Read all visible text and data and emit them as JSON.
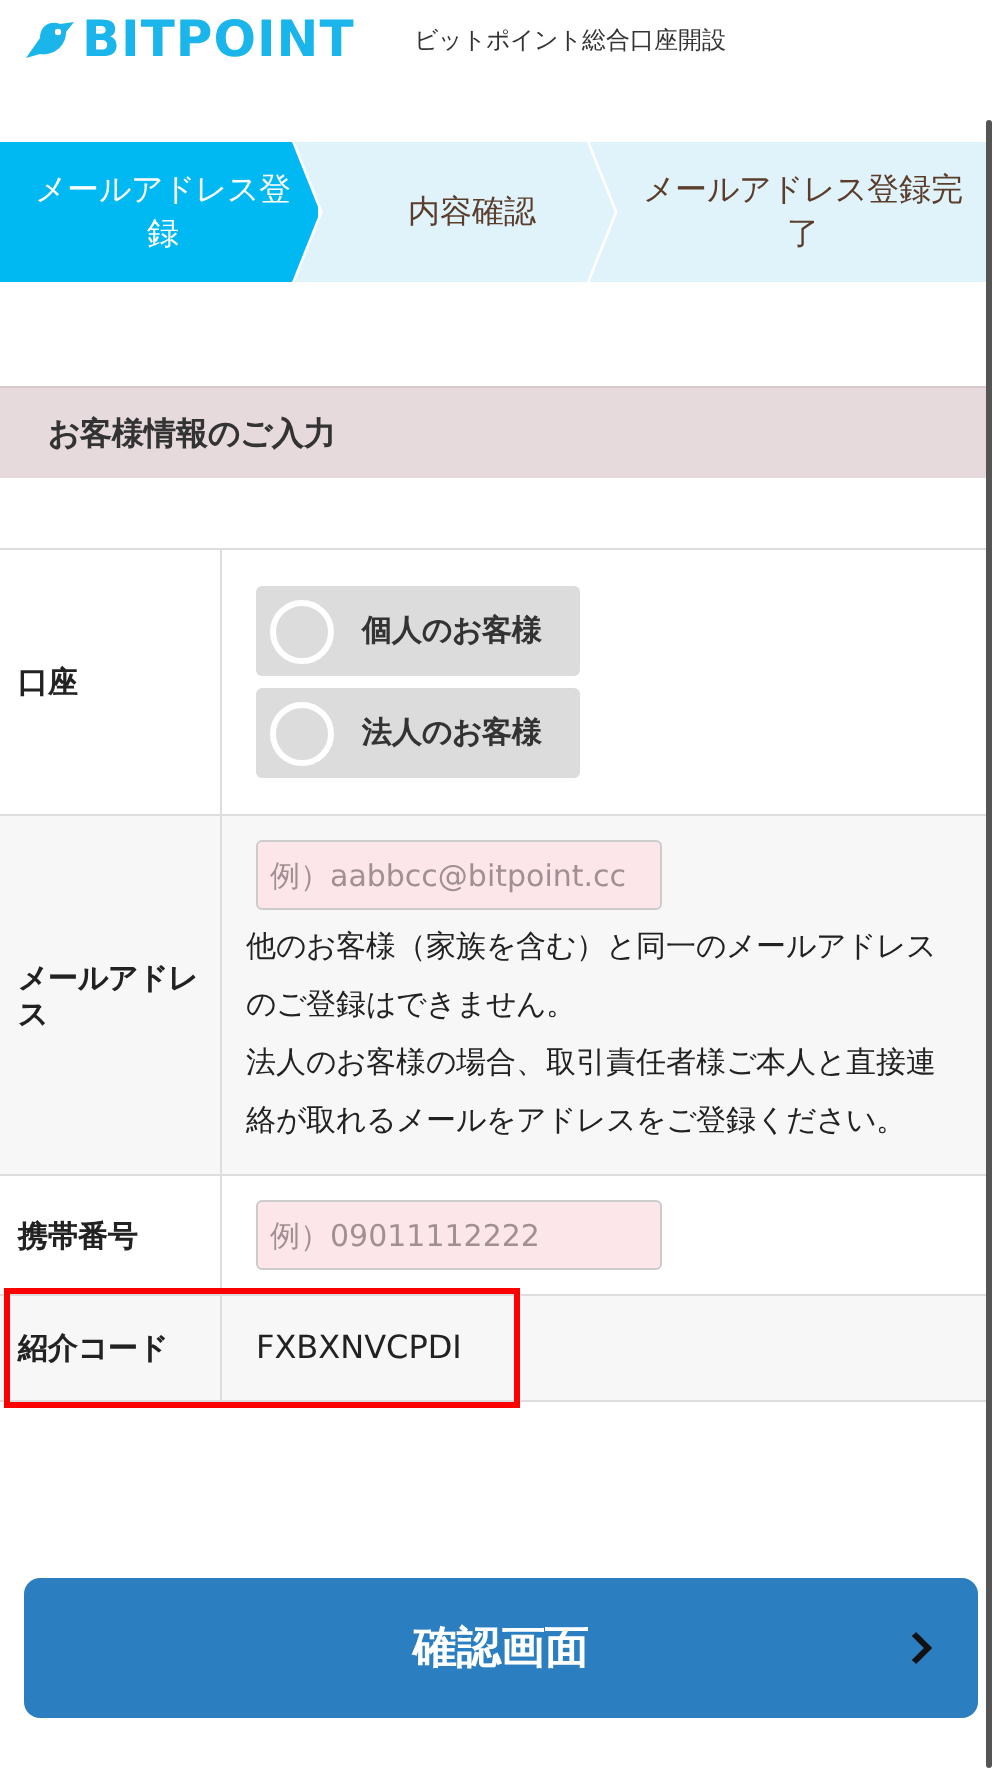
{
  "header": {
    "logo_text": "BITPOINT",
    "title": "ビットポイント総合口座開設"
  },
  "steps": [
    {
      "label": "メールアドレス登録",
      "selected": true
    },
    {
      "label": "内容確認",
      "selected": false
    },
    {
      "label": "メールアドレス登録完了",
      "selected": false
    }
  ],
  "section_title": "お客様情報のご入力",
  "form_rows": [
    {
      "kind": "radio",
      "label": "口座",
      "highlighted": false,
      "options": [
        {
          "label": "個人のお客様",
          "selected": false
        },
        {
          "label": "法人のお客様",
          "selected": false
        }
      ]
    },
    {
      "kind": "input",
      "label": "メールアドレス",
      "highlighted": false,
      "placeholder": "例）aabbcc@bitpoint.cc",
      "notes": [
        "他のお客様（家族を含む）と同一のメールアドレスのご登録はできません。",
        "法人のお客様の場合、取引責任者様ご本人と直接連絡が取れるメールをアドレスをご登録ください。"
      ]
    },
    {
      "kind": "input",
      "label": "携帯番号",
      "highlighted": false,
      "placeholder": "例）09011112222"
    },
    {
      "kind": "value",
      "label": "紹介コード",
      "highlighted": true,
      "value": "FXBXNVCPDI"
    }
  ],
  "submit_button": {
    "label": "確認画面"
  }
}
